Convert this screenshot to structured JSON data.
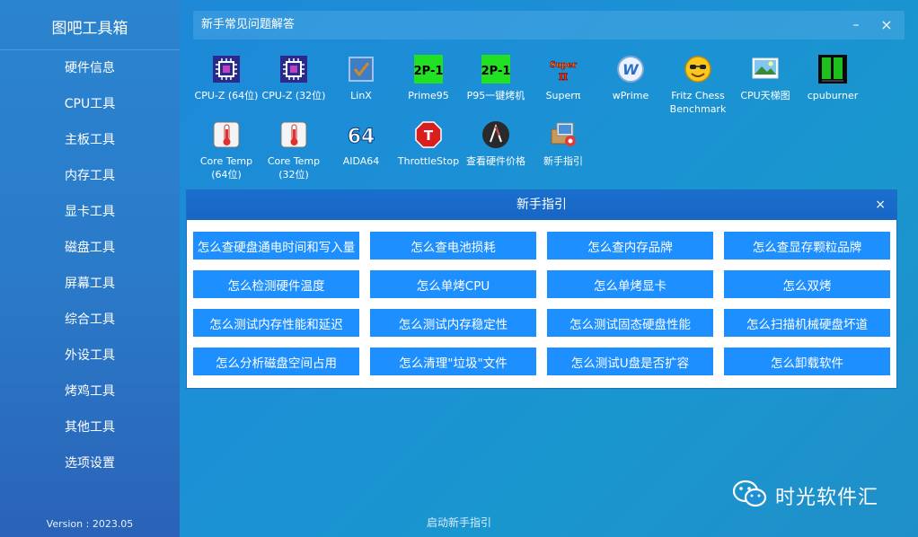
{
  "sidebar": {
    "title": "图吧工具箱",
    "items": [
      {
        "label": "硬件信息"
      },
      {
        "label": "CPU工具"
      },
      {
        "label": "主板工具"
      },
      {
        "label": "内存工具"
      },
      {
        "label": "显卡工具"
      },
      {
        "label": "磁盘工具"
      },
      {
        "label": "屏幕工具"
      },
      {
        "label": "综合工具"
      },
      {
        "label": "外设工具"
      },
      {
        "label": "烤鸡工具"
      },
      {
        "label": "其他工具"
      },
      {
        "label": "选项设置"
      }
    ],
    "version": "Version : 2023.05"
  },
  "header": {
    "title": "新手常见问题解答",
    "minimize": "–",
    "close": "×"
  },
  "tools": [
    {
      "label": "CPU-Z (64位)",
      "icon": "cpuz-icon"
    },
    {
      "label": "CPU-Z (32位)",
      "icon": "cpuz-icon"
    },
    {
      "label": "LinX",
      "icon": "linx-icon"
    },
    {
      "label": "Prime95",
      "icon": "prime95-icon",
      "glyph": "2P-1"
    },
    {
      "label": "P95一键烤机",
      "icon": "prime95-icon",
      "glyph": "2P-1"
    },
    {
      "label": "Superπ",
      "icon": "superpi-icon",
      "glyph": "Super π"
    },
    {
      "label": "wPrime",
      "icon": "wprime-icon",
      "glyph": "W"
    },
    {
      "label": "Fritz Chess\nBenchmark",
      "icon": "chess-smiley-icon"
    },
    {
      "label": "CPU天梯图",
      "icon": "picture-icon"
    },
    {
      "label": "cpuburner",
      "icon": "cpuburner-icon"
    },
    {
      "label": "Core Temp\n(64位)",
      "icon": "thermometer-icon"
    },
    {
      "label": "Core Temp\n(32位)",
      "icon": "thermometer-icon"
    },
    {
      "label": "AIDA64",
      "icon": "aida64-icon",
      "glyph": "64"
    },
    {
      "label": "ThrottleStop",
      "icon": "stop-sign-icon",
      "glyph": "T"
    },
    {
      "label": "查看硬件价格",
      "icon": "price-icon"
    },
    {
      "label": "新手指引",
      "icon": "guide-icon"
    }
  ],
  "dialog": {
    "title": "新手指引",
    "close": "×",
    "buttons": [
      {
        "label": "怎么查硬盘通电时间和写入量"
      },
      {
        "label": "怎么查电池损耗"
      },
      {
        "label": "怎么查内存品牌"
      },
      {
        "label": "怎么查显存颗粒品牌"
      },
      {
        "label": "怎么检测硬件温度"
      },
      {
        "label": "怎么单烤CPU"
      },
      {
        "label": "怎么单烤显卡"
      },
      {
        "label": "怎么双烤"
      },
      {
        "label": "怎么测试内存性能和延迟"
      },
      {
        "label": "怎么测试内存稳定性"
      },
      {
        "label": "怎么测试固态硬盘性能"
      },
      {
        "label": "怎么扫描机械硬盘坏道"
      },
      {
        "label": "怎么分析磁盘空间占用"
      },
      {
        "label": "怎么清理\"垃圾\"文件"
      },
      {
        "label": "怎么测试U盘是否扩容"
      },
      {
        "label": "怎么卸载软件"
      }
    ]
  },
  "footer": {
    "link": "启动新手指引"
  },
  "watermark": {
    "text": "时光软件汇",
    "icon": "wechat-icon"
  },
  "colors": {
    "accent": "#1e8fff",
    "dialog_header": "#1a6fce",
    "sidebar": "#2a7bc9"
  }
}
